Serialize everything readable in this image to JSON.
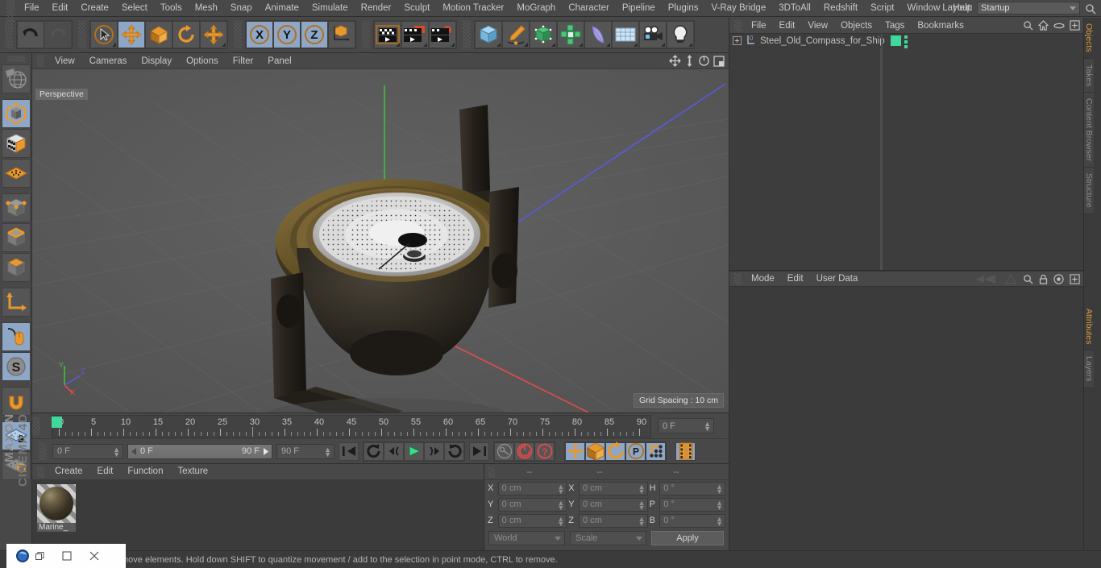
{
  "app": {
    "brand_top": "MAXON",
    "brand_bottom": "CINEMA 4D"
  },
  "menubar": {
    "items": [
      "File",
      "Edit",
      "Create",
      "Select",
      "Tools",
      "Mesh",
      "Snap",
      "Animate",
      "Simulate",
      "Render",
      "Sculpt",
      "Motion Tracker",
      "MoGraph",
      "Character",
      "Pipeline",
      "Plugins",
      "V-Ray Bridge",
      "3DToAll",
      "Redshift",
      "Script",
      "Window",
      "Help"
    ],
    "layout_label": "Layout:",
    "layout_value": "Startup",
    "search_icon": "search-icon"
  },
  "toolbar": {
    "groups": [
      {
        "name": "history",
        "buttons": [
          {
            "name": "undo-button",
            "icon": "undo-arrow-icon",
            "selected": false,
            "disabled": false
          },
          {
            "name": "redo-button",
            "icon": "redo-arrow-icon",
            "selected": false,
            "disabled": true
          }
        ]
      },
      {
        "name": "transform-tools",
        "buttons": [
          {
            "name": "live-selection-tool",
            "icon": "cursor-circle-icon",
            "selected": false,
            "corner": true
          },
          {
            "name": "move-tool",
            "icon": "move-arrows-icon",
            "selected": true
          },
          {
            "name": "scale-tool",
            "icon": "scale-box-icon",
            "selected": false
          },
          {
            "name": "rotate-tool",
            "icon": "rotate-arc-icon",
            "selected": false
          },
          {
            "name": "free-transform-tool",
            "icon": "move-arrows-icon",
            "selected": false,
            "corner": true
          }
        ]
      },
      {
        "name": "axis-locks",
        "buttons": [
          {
            "name": "lock-x-axis",
            "icon": "x-axis-icon",
            "selected": true,
            "label": "X"
          },
          {
            "name": "lock-y-axis",
            "icon": "y-axis-icon",
            "selected": true,
            "label": "Y"
          },
          {
            "name": "lock-z-axis",
            "icon": "z-axis-icon",
            "selected": true,
            "label": "Z"
          },
          {
            "name": "world-object-axis-toggle",
            "icon": "world-axis-cube-icon",
            "selected": false
          }
        ]
      },
      {
        "name": "render-tools",
        "buttons": [
          {
            "name": "render-view-button",
            "icon": "render-view-icon",
            "selected": false,
            "corner": true
          },
          {
            "name": "render-region-button",
            "icon": "render-region-icon",
            "selected": false,
            "corner": true
          },
          {
            "name": "render-settings-button",
            "icon": "render-settings-gear-icon",
            "selected": false,
            "corner": true
          }
        ]
      },
      {
        "name": "create-objects",
        "buttons": [
          {
            "name": "add-cube-button",
            "icon": "cube-icon",
            "selected": false,
            "corner": true
          },
          {
            "name": "add-spline-button",
            "icon": "pen-spline-icon",
            "selected": false,
            "corner": true
          },
          {
            "name": "add-generator-button",
            "icon": "generator-cube-icon",
            "selected": false,
            "corner": true
          },
          {
            "name": "add-mograph-button",
            "icon": "mograph-cluster-icon",
            "selected": false,
            "corner": true
          },
          {
            "name": "add-deformer-button",
            "icon": "bend-deformer-icon",
            "selected": false,
            "corner": true
          },
          {
            "name": "add-scene-button",
            "icon": "floor-grid-icon",
            "selected": false,
            "corner": true
          },
          {
            "name": "add-camera-button",
            "icon": "camera-icon",
            "selected": false,
            "corner": true
          },
          {
            "name": "add-light-button",
            "icon": "light-bulb-icon",
            "selected": false,
            "corner": true
          }
        ]
      }
    ]
  },
  "left_toolbar": {
    "buttons": [
      {
        "name": "make-editable-button",
        "icon": "globe-mesh-icon",
        "selected": false
      },
      {
        "name": "model-mode-button",
        "icon": "model-cube-icon",
        "selected": true,
        "corner": true
      },
      {
        "name": "texture-mode-button",
        "icon": "texture-checker-cube-icon",
        "selected": false
      },
      {
        "name": "deformer-mode-button",
        "icon": "deformer-grid-icon",
        "selected": false
      },
      {
        "name": "points-mode-button",
        "icon": "points-cube-icon",
        "selected": false
      },
      {
        "name": "edges-mode-button",
        "icon": "edges-cube-icon",
        "selected": false
      },
      {
        "name": "polygons-mode-button",
        "icon": "polygon-cube-icon",
        "selected": false
      },
      {
        "name": "axis-mode-button",
        "icon": "axis-arrow-icon",
        "selected": false
      },
      {
        "name": "viewport-solo-button",
        "icon": "mouse-icon",
        "selected": true
      },
      {
        "name": "snap-toggle-button",
        "icon": "snap-s-icon",
        "selected": true,
        "corner": true
      },
      {
        "name": "magnet-tool-button",
        "icon": "magnet-icon",
        "selected": false,
        "corner": true
      },
      {
        "name": "workplane-lock-button",
        "icon": "workplane-lock-icon",
        "selected": true,
        "corner": true
      },
      {
        "name": "workplane-button",
        "icon": "workplane-rotate-icon",
        "selected": false,
        "corner": true
      }
    ]
  },
  "viewport": {
    "menu": [
      "View",
      "Cameras",
      "Display",
      "Options",
      "Filter",
      "Panel"
    ],
    "icons": [
      "pan-icon",
      "dolly-icon",
      "rotate-icon",
      "panel-layout-icon"
    ],
    "perspective_label": "Perspective",
    "grid_spacing_label": "Grid Spacing : 10 cm",
    "axis_labels": {
      "x": "X",
      "y": "Y",
      "z": "Z"
    }
  },
  "timeline": {
    "ticks": [
      0,
      5,
      10,
      15,
      20,
      25,
      30,
      35,
      40,
      45,
      50,
      55,
      60,
      65,
      70,
      75,
      80,
      85,
      90
    ],
    "playhead_frame": 0,
    "current_frame_field": "0 F"
  },
  "transport": {
    "start_frame_field": "0 F",
    "range_start": "0 F",
    "range_end": "90 F",
    "end_frame_field": "90 F",
    "buttons": [
      {
        "name": "go-to-start-button",
        "icon": "skip-start-icon"
      },
      {
        "name": "previous-keyframe-button",
        "icon": "rewind-loop-icon"
      },
      {
        "name": "step-back-button",
        "icon": "step-back-icon"
      },
      {
        "name": "play-button",
        "icon": "play-triangle-icon",
        "accent": "#3ddc84"
      },
      {
        "name": "step-forward-button",
        "icon": "step-forward-icon"
      },
      {
        "name": "next-keyframe-button",
        "icon": "forward-loop-icon"
      },
      {
        "name": "go-to-end-button",
        "icon": "skip-end-icon"
      },
      {
        "name": "autokey-button",
        "icon": "key-icon"
      },
      {
        "name": "record-active-objects-button",
        "icon": "record-circle-icon",
        "accent": "#d84a4a"
      },
      {
        "name": "keyframe-help-button",
        "icon": "question-circle-icon",
        "accent": "#d84a4a"
      },
      {
        "name": "record-position-button",
        "icon": "position-arrows-icon",
        "selected": true
      },
      {
        "name": "record-scale-button",
        "icon": "scale-box-icon",
        "selected": true
      },
      {
        "name": "record-rotation-button",
        "icon": "rotate-arc-icon",
        "selected": true
      },
      {
        "name": "record-pla-button",
        "icon": "pla-p-icon",
        "selected": true
      },
      {
        "name": "keyframe-selection-button",
        "icon": "dot-matrix-icon",
        "selected": true
      },
      {
        "name": "timeline-toggle-button",
        "icon": "filmstrip-icon",
        "selected": true
      }
    ]
  },
  "materials": {
    "menu": [
      "Create",
      "Edit",
      "Function",
      "Texture"
    ],
    "items": [
      {
        "name": "Marine_",
        "thumbnail": "sphere-preview"
      }
    ]
  },
  "coordinates": {
    "header_dashes": [
      "--",
      "--",
      "--"
    ],
    "rows": [
      {
        "pos_label": "X",
        "pos_value": "0 cm",
        "size_label": "X",
        "size_value": "0 cm",
        "rot_label": "H",
        "rot_value": "0 °"
      },
      {
        "pos_label": "Y",
        "pos_value": "0 cm",
        "size_label": "Y",
        "size_value": "0 cm",
        "rot_label": "P",
        "rot_value": "0 °"
      },
      {
        "pos_label": "Z",
        "pos_value": "0 cm",
        "size_label": "Z",
        "size_value": "0 cm",
        "rot_label": "B",
        "rot_value": "0 °"
      }
    ],
    "world_select": "World",
    "scale_select": "Scale",
    "apply_button": "Apply"
  },
  "objects_panel": {
    "menu": [
      "File",
      "Edit",
      "View",
      "Objects",
      "Tags",
      "Bookmarks"
    ],
    "icons": [
      "search-icon",
      "home-icon",
      "ellipse-icon",
      "plus-box-icon"
    ],
    "items": [
      {
        "name": "Steel_Old_Compass_for_Ship",
        "layer_color": "#3fd99b",
        "expandable": true,
        "tag": "layer-tag"
      }
    ]
  },
  "attributes_panel": {
    "menu": [
      "Mode",
      "Edit",
      "User Data"
    ],
    "icons": [
      "history-back-icon",
      "history-forward-icon",
      "search-icon",
      "lock-icon",
      "target-icon",
      "plus-box-icon"
    ]
  },
  "vertical_tabs": [
    {
      "label": "Objects",
      "active": true
    },
    {
      "label": "Takes",
      "active": false
    },
    {
      "label": "Content Browser",
      "active": false
    },
    {
      "label": "Structure",
      "active": false
    },
    {
      "label": "Attributes",
      "active": true
    },
    {
      "label": "Layers",
      "active": false
    }
  ],
  "status_bar": {
    "text": "move elements. Hold down SHIFT to quantize movement / add to the selection in point mode, CTRL to remove."
  },
  "window_widget": {
    "icons": [
      "app-orb-icon",
      "restore-icon",
      "minimize-icon",
      "close-icon"
    ]
  },
  "colors": {
    "accent_orange": "#e08a2e",
    "selected_blue": "#8fa7c6",
    "green": "#3fd99b",
    "panel_bg": "#3b3b3b",
    "toolbar_bg": "#484848"
  }
}
